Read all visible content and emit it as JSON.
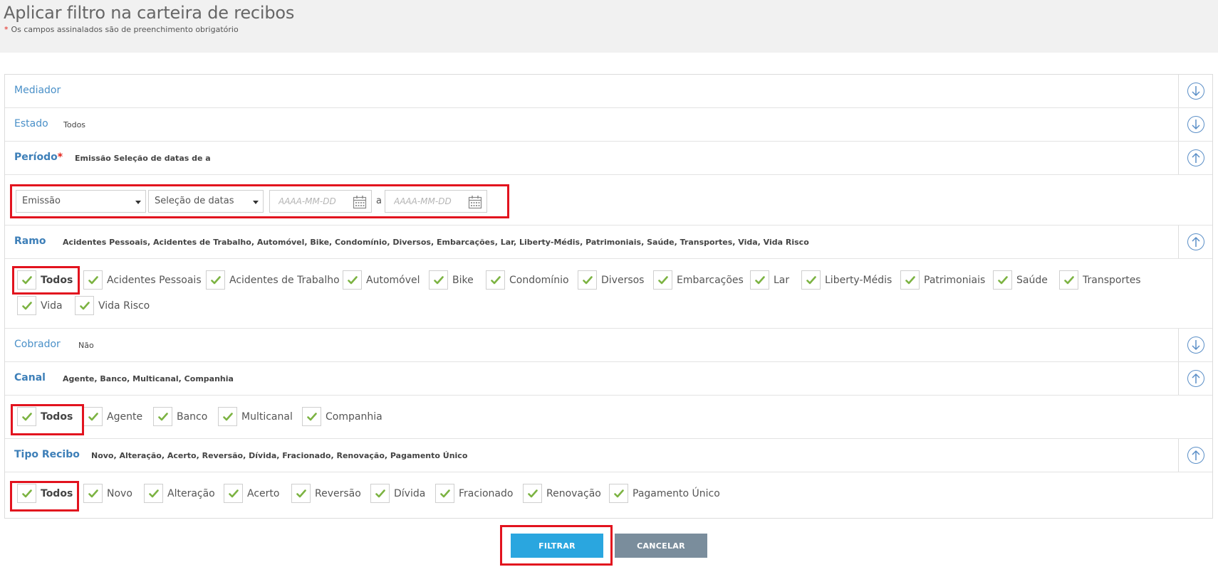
{
  "header": {
    "title": "Aplicar filtro na carteira de recibos",
    "required_star": "*",
    "required_note": "Os campos assinalados são de preenchimento obrigatório"
  },
  "mediador": {
    "label": "Mediador"
  },
  "estado": {
    "label": "Estado",
    "value": "Todos"
  },
  "periodo": {
    "label": "Período",
    "required_star": "*",
    "value": "Emissão Seleção de datas de a",
    "type_select": "Emissão",
    "range_select": "Seleção de datas",
    "date_from_placeholder": "AAAA-MM-DD",
    "date_sep": "a",
    "date_to_placeholder": "AAAA-MM-DD"
  },
  "ramo": {
    "label": "Ramo",
    "value": "Acidentes Pessoais, Acidentes de Trabalho, Automóvel, Bike, Condomínio, Diversos, Embarcações, Lar, Liberty-Médis, Patrimoniais, Saúde, Transportes, Vida, Vida Risco",
    "options": [
      "Todos",
      "Acidentes Pessoais",
      "Acidentes de Trabalho",
      "Automóvel",
      "Bike",
      "Condomínio",
      "Diversos",
      "Embarcações",
      "Lar",
      "Liberty-Médis",
      "Patrimoniais",
      "Saúde",
      "Transportes",
      "Vida",
      "Vida Risco"
    ]
  },
  "cobrador": {
    "label": "Cobrador",
    "value": "Não"
  },
  "canal": {
    "label": "Canal",
    "value": "Agente, Banco, Multicanal, Companhia",
    "options": [
      "Todos",
      "Agente",
      "Banco",
      "Multicanal",
      "Companhia"
    ]
  },
  "tipo_recibo": {
    "label": "Tipo Recibo",
    "value": "Novo, Alteração, Acerto, Reversão, Dívida, Fracionado, Renovação, Pagamento Único",
    "options": [
      "Todos",
      "Novo",
      "Alteração",
      "Acerto",
      "Reversão",
      "Dívida",
      "Fracionado",
      "Renovação",
      "Pagamento Único"
    ]
  },
  "actions": {
    "filter_label": "FILTRAR",
    "cancel_label": "CANCELAR"
  },
  "colors": {
    "accent": "#2aa6df",
    "label_blue": "#4a90c8",
    "check_green": "#7cb342",
    "highlight_red": "#e2131e",
    "cancel_grey": "#7a8d9c"
  },
  "icons": {
    "toggle_down": "arrow-down-circle-icon",
    "toggle_up": "arrow-up-circle-icon",
    "check": "check-icon",
    "calendar": "calendar-icon"
  }
}
